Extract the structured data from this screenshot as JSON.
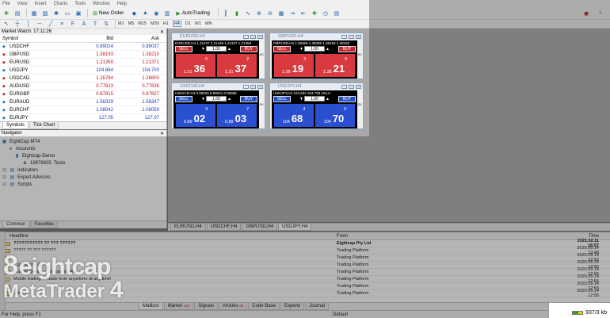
{
  "menu": [
    "File",
    "View",
    "Insert",
    "Charts",
    "Tools",
    "Window",
    "Help"
  ],
  "toolbar": {
    "new_order": "New Order",
    "auto_trading": "AutoTrading",
    "timeframes": [
      "M1",
      "M5",
      "M15",
      "M30",
      "H1",
      "H4",
      "D1",
      "W1",
      "MN"
    ],
    "active_timeframe": "H4"
  },
  "market_watch": {
    "title": "Market Watch: 17:11:26",
    "headers": {
      "symbol": "Symbol",
      "bid": "Bid",
      "ask": "Ask"
    },
    "rows": [
      {
        "symbol": "USDCHF",
        "bid": "0.89024",
        "ask": "0.89037",
        "dir": "up"
      },
      {
        "symbol": "GBPUSD",
        "bid": "1.38193",
        "ask": "1.38210",
        "dir": "dn"
      },
      {
        "symbol": "EURUSD",
        "bid": "1.21359",
        "ask": "1.21371",
        "dir": "dn"
      },
      {
        "symbol": "USDJPY",
        "bid": "104.684",
        "ask": "104.700",
        "dir": "up"
      },
      {
        "symbol": "USDCAD",
        "bid": "1.26784",
        "ask": "1.26800",
        "dir": "dn"
      },
      {
        "symbol": "AUDUSD",
        "bid": "0.77623",
        "ask": "0.77636",
        "dir": "dn"
      },
      {
        "symbol": "EURGBP",
        "bid": "0.87815",
        "ask": "0.87827",
        "dir": "dn"
      },
      {
        "symbol": "EURAUD",
        "bid": "1.56329",
        "ask": "1.56347",
        "dir": "up"
      },
      {
        "symbol": "EURCHF",
        "bid": "1.08042",
        "ask": "1.08059",
        "dir": "up"
      },
      {
        "symbol": "EURJPY",
        "bid": "127.05",
        "ask": "127.07",
        "dir": "up"
      }
    ],
    "tabs": [
      "Symbols",
      "Tick Chart"
    ]
  },
  "navigator": {
    "title": "Navigator",
    "root": "EightCap MT4",
    "accounts": "Accounts",
    "server": "Eightcap-Demo",
    "account": "19978925: Testo",
    "indicators": "Indicators",
    "experts": "Expert Advisors",
    "scripts": "Scripts",
    "tabs": [
      "Common",
      "Favorites"
    ]
  },
  "trade_windows": [
    {
      "title": "EURUSD,H4",
      "info": "EURUSD,H4  1.21437 1.21448 1.21337 1.21359",
      "sell": "SELL",
      "buy": "BUY",
      "lot": "1.00",
      "bid_pre": "1.21",
      "bid_big": "36",
      "bid_sup": "0",
      "ask_pre": "1.21",
      "ask_big": "37",
      "ask_sup": "2",
      "theme": "red",
      "side": "ASK"
    },
    {
      "title": "GBPUSD,H4",
      "info": "GBPUSD,H4  1.38369 1.38369 1.38193 1.38193",
      "sell": "SELL",
      "buy": "BUY",
      "lot": "1.00",
      "bid_pre": "1.38",
      "bid_big": "19",
      "bid_sup": "3",
      "ask_pre": "1.38",
      "ask_big": "21",
      "ask_sup": "0",
      "theme": "red",
      "side": "ASK"
    },
    {
      "title": "USDCHF,H4",
      "info": "USDCHF,H4  0.89026 0.89041 0.88986",
      "sell": "SELL",
      "buy": "BUY",
      "lot": "1.00",
      "bid_pre": "0.89",
      "bid_big": "02",
      "bid_sup": "3",
      "ask_pre": "0.89",
      "ask_big": "03",
      "ask_sup": "7",
      "theme": "blue",
      "side": "ASK"
    },
    {
      "title": "USDJPY,H4",
      "info": "USDJPY,H4  104.682 104.793 104.6",
      "sell": "SELL",
      "buy": "BUY",
      "lot": "1.00",
      "bid_pre": "104",
      "bid_big": "68",
      "bid_sup": "4",
      "ask_pre": "104",
      "ask_big": "70",
      "ask_sup": "0",
      "theme": "blue",
      "side": "ASK"
    }
  ],
  "chart_tabs": [
    "EURUSD,H4",
    "USDCHF,H4",
    "GBPUSD,H4",
    "USDJPY,H4"
  ],
  "active_chart_tab": "USDJPY,H4",
  "terminal": {
    "headers": {
      "headline": "Headline",
      "from": "From",
      "time": "Time"
    },
    "rows": [
      {
        "headline": "??????????? ?? ??? ??????",
        "from": "Eightcap Pty Ltd",
        "time": "2021.02.11 16:57",
        "bold": true
      },
      {
        "headline": "????? ?? ??? ??????",
        "from": "Trading Platform",
        "time": "2020.09.14 13:48",
        "bold": false
      },
      {
        "headline": "",
        "from": "Trading Platform",
        "time": "2020.09.14 12:55",
        "bold": false
      },
      {
        "headline": "...gy trading 24/7",
        "from": "Trading Platform",
        "time": "2020.09.14 12:55",
        "bold": false
      },
      {
        "headline": "Trading Signals and copy trading",
        "from": "Trading Platform",
        "time": "2020.09.14 12:55",
        "bold": false
      },
      {
        "headline": "Mobile trading — trade from anywhere at any time!",
        "from": "Trading Platform",
        "time": "2020.09.14 12:55",
        "bold": false
      },
      {
        "headline": "",
        "from": "Trading Platform",
        "time": "2020.09.14 12:55",
        "bold": false
      },
      {
        "headline": "...Ma...",
        "from": "Trading Platform",
        "time": "2020.09.14 12:55",
        "bold": false
      }
    ],
    "tabs": [
      {
        "label": "Mailbox",
        "count": ""
      },
      {
        "label": "Market",
        "count": "125"
      },
      {
        "label": "Signals",
        "count": ""
      },
      {
        "label": "Articles",
        "count": "96"
      },
      {
        "label": "Code Base",
        "count": ""
      },
      {
        "label": "Experts",
        "count": ""
      },
      {
        "label": "Journal",
        "count": ""
      }
    ],
    "side_label": "Terminal"
  },
  "statusbar": {
    "help": "For Help, press F1",
    "profile": "Default",
    "traffic": "937/3 kb"
  },
  "brand": {
    "line1": "eightcap",
    "line2": "MetaTrader",
    "line2_num": "4",
    "mark": "8"
  }
}
